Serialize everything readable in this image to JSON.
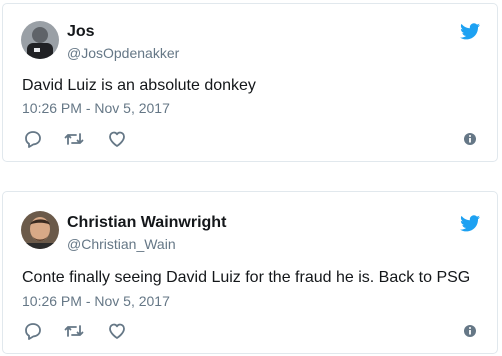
{
  "colors": {
    "twitter_blue": "#1da1f2",
    "text_primary": "#14171a",
    "text_secondary": "#657786",
    "border": "#e1e8ed"
  },
  "tweets": [
    {
      "display_name": "Jos",
      "handle": "@JosOpdenakker",
      "text": "David Luiz is an absolute donkey",
      "timestamp": "10:26 PM - Nov 5, 2017",
      "icons": [
        "twitter-bird-icon",
        "reply-icon",
        "retweet-icon",
        "like-icon",
        "info-icon"
      ]
    },
    {
      "display_name": "Christian Wainwright",
      "handle": "@Christian_Wain",
      "text": "Conte finally seeing David Luiz for the fraud he is. Back to PSG",
      "timestamp": "10:26 PM - Nov 5, 2017",
      "icons": [
        "twitter-bird-icon",
        "reply-icon",
        "retweet-icon",
        "like-icon",
        "info-icon"
      ]
    }
  ]
}
